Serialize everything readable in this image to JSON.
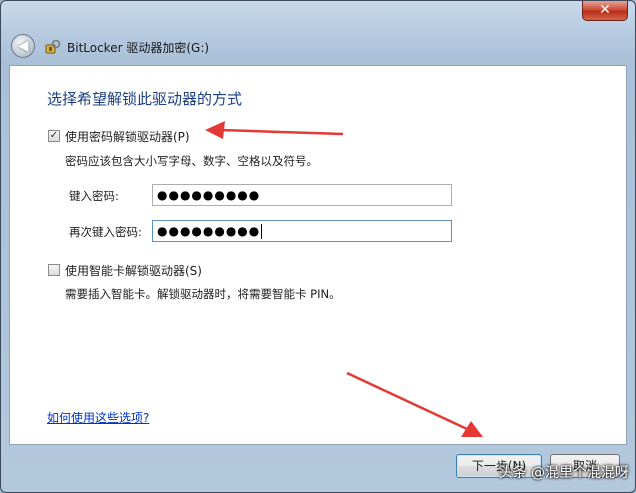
{
  "window": {
    "title": "BitLocker 驱动器加密(G:)",
    "close_label": "✕"
  },
  "main": {
    "heading": "选择希望解锁此驱动器的方式",
    "password_option": {
      "label": "使用密码解锁驱动器(P)",
      "checked": true,
      "description": "密码应该包含大小写字母、数字、空格以及符号。",
      "enter_label": "键入密码:",
      "enter_value": "●●●●●●●●●",
      "reenter_label": "再次键入密码:",
      "reenter_value": "●●●●●●●●●"
    },
    "smartcard_option": {
      "label": "使用智能卡解锁驱动器(S)",
      "checked": false,
      "description": "需要插入智能卡。解锁驱动器时，将需要智能卡 PIN。"
    },
    "help_link": "如何使用这些选项?"
  },
  "footer": {
    "next_label": "下一步(N)",
    "cancel_label": "取消"
  },
  "watermark": "头条 @混里个混混呀",
  "colors": {
    "heading": "#1d3f83",
    "link": "#0033cc",
    "annotation_arrow": "#e53935"
  }
}
